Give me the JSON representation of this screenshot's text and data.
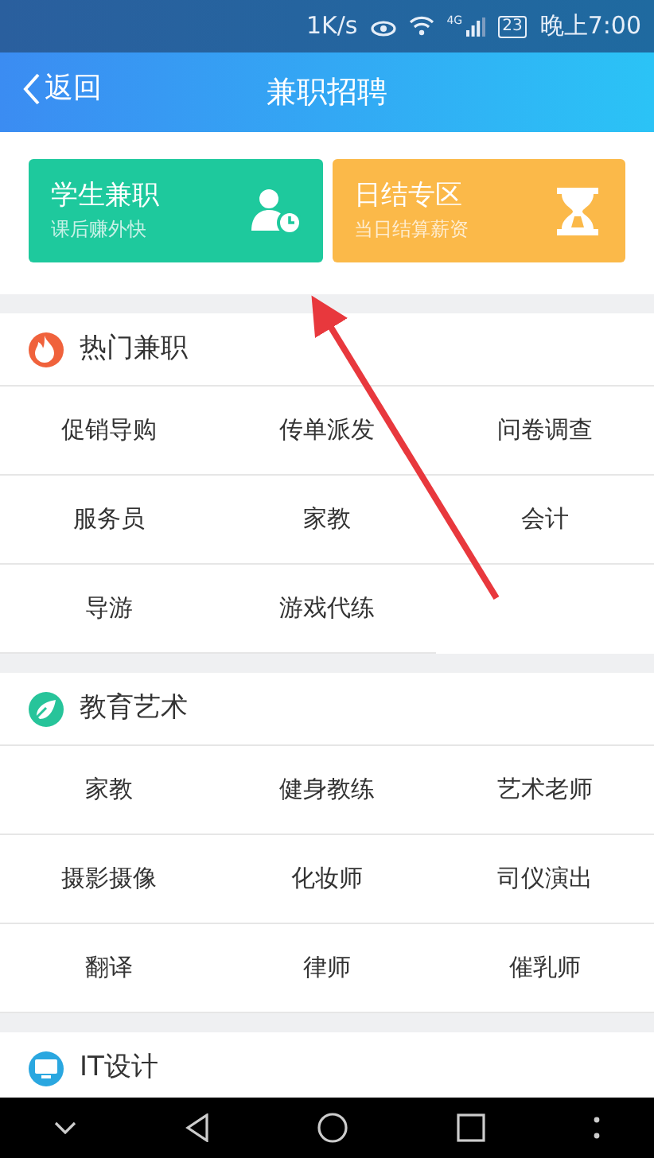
{
  "status_bar": {
    "speed": "1K/s",
    "network": "4G",
    "battery": "23",
    "time": "晚上7:00"
  },
  "header": {
    "back": "返回",
    "title": "兼职招聘"
  },
  "promo_cards": [
    {
      "title": "学生兼职",
      "subtitle": "课后赚外快",
      "kind": "student",
      "color": "#1ec99d"
    },
    {
      "title": "日结专区",
      "subtitle": "当日结算薪资",
      "kind": "daily",
      "color": "#fbb949"
    }
  ],
  "sections": [
    {
      "title": "热门兼职",
      "kind": "hot",
      "color": "#f0623c",
      "items": [
        "促销导购",
        "传单派发",
        "问卷调查",
        "服务员",
        "家教",
        "会计",
        "导游",
        "游戏代练"
      ]
    },
    {
      "title": "教育艺术",
      "kind": "edu",
      "color": "#27c49a",
      "items": [
        "家教",
        "健身教练",
        "艺术老师",
        "摄影摄像",
        "化妆师",
        "司仪演出",
        "翻译",
        "律师",
        "催乳师"
      ]
    },
    {
      "title": "IT设计",
      "kind": "it",
      "color": "#2aa7e0"
    }
  ]
}
